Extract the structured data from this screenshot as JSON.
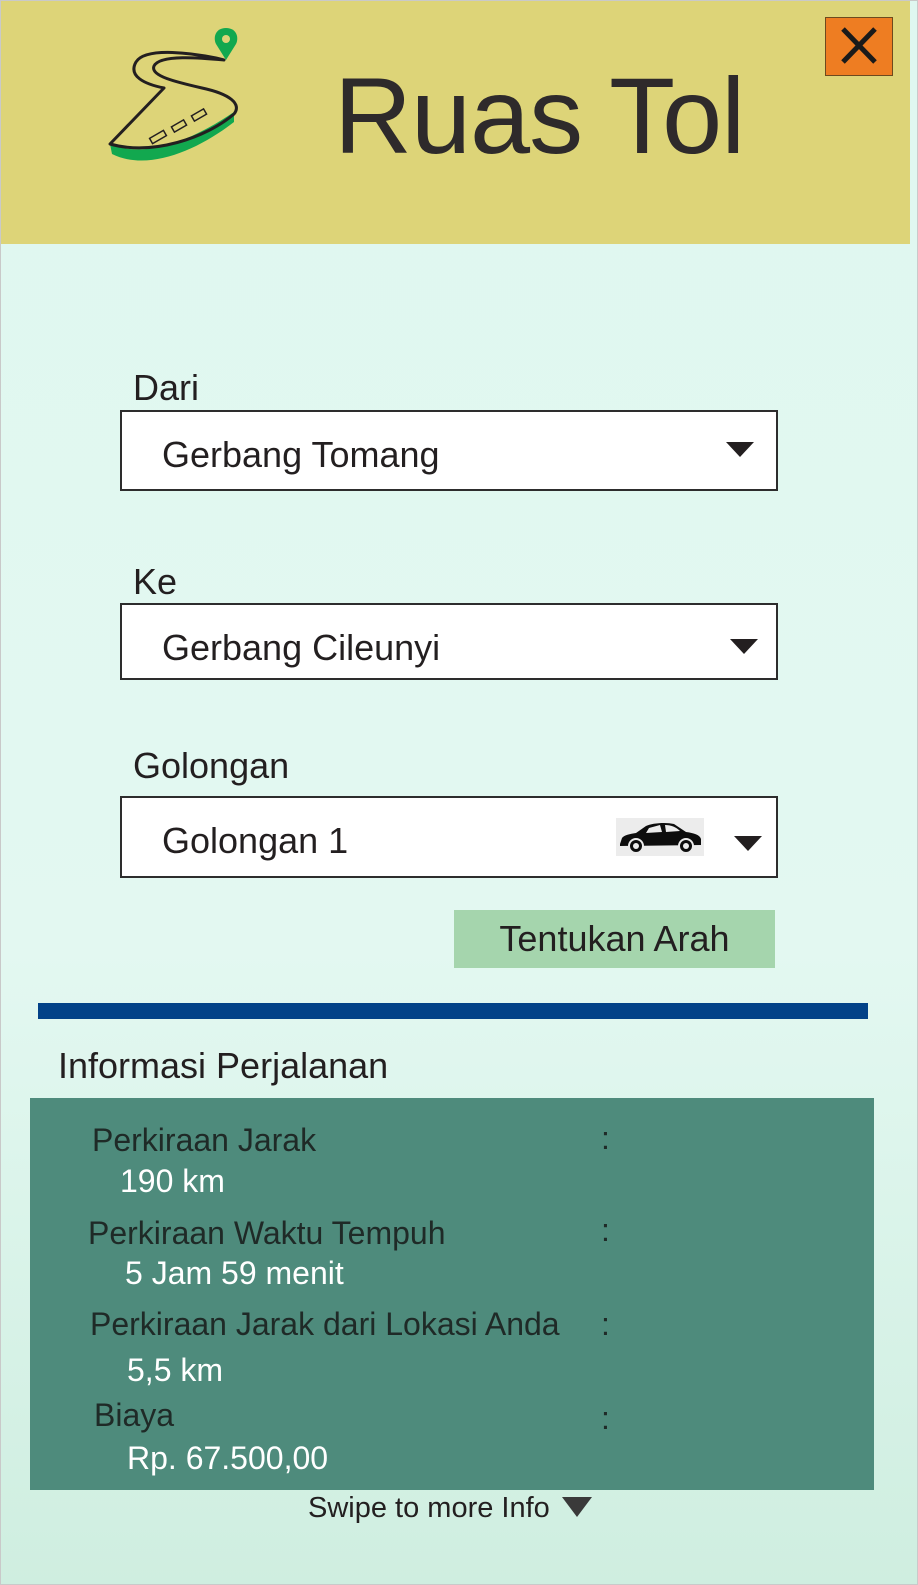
{
  "header": {
    "title": "Ruas Tol",
    "logo_icon": "winding-road-with-location-pin-icon",
    "close_icon": "close-x-icon",
    "colors": {
      "header_bg": "#ddd478",
      "close_bg": "#ee7d22",
      "accent_green": "#12a84f"
    }
  },
  "form": {
    "from": {
      "label": "Dari",
      "value": "Gerbang Tomang"
    },
    "to": {
      "label": "Ke",
      "value": "Gerbang Cileunyi"
    },
    "class": {
      "label": "Golongan",
      "value": "Golongan 1",
      "icon": "car-icon"
    },
    "dropdown_icon": "caret-down-icon",
    "submit_label": "Tentukan Arah"
  },
  "divider_color": "#024288",
  "info": {
    "title": "Informasi Perjalanan",
    "panel_color": "#4e8b7c",
    "colon": ":",
    "items": [
      {
        "label": "Perkiraan Jarak",
        "value": "190 km"
      },
      {
        "label": "Perkiraan Waktu Tempuh",
        "value": "5 Jam 59 menit"
      },
      {
        "label": "Perkiraan Jarak dari Lokasi Anda",
        "value": "5,5 km"
      },
      {
        "label": "Biaya",
        "value": "Rp. 67.500,00"
      }
    ]
  },
  "footer": {
    "swipe_text": "Swipe to more Info",
    "swipe_icon": "caret-down-icon"
  }
}
